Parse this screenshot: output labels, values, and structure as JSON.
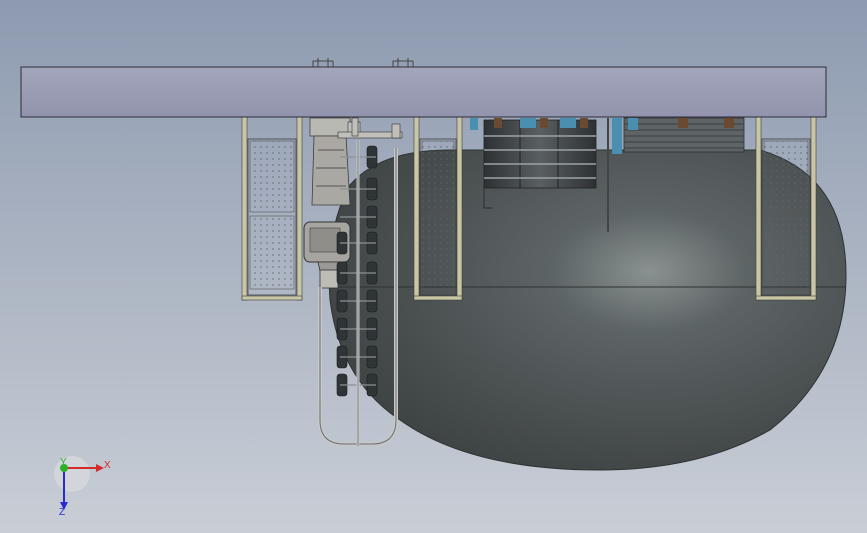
{
  "view": {
    "colors": {
      "background_top": "#8d9ab0",
      "background_bottom": "#c9ced6",
      "beam": "#9b9db5",
      "tank": "#4d5354",
      "frame": "#c8c4a0",
      "axis_x": "#d42a2a",
      "axis_y": "#2ab32a",
      "axis_z": "#2a2ad4"
    }
  },
  "triad": {
    "x_label": "X",
    "y_label": "Y",
    "z_label": "Z"
  }
}
